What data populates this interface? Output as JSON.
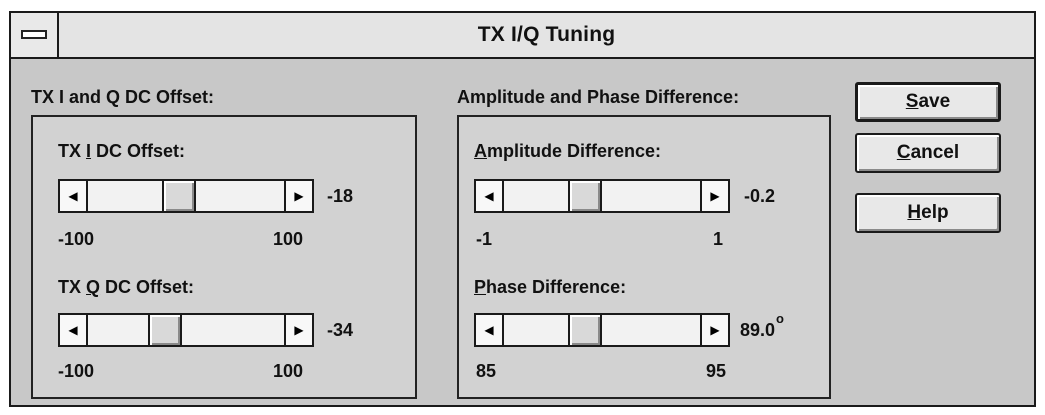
{
  "window": {
    "title": "TX I/Q Tuning"
  },
  "dc_offset": {
    "group_label": "TX I and Q DC Offset:",
    "i_slider": {
      "label_prefix": "TX ",
      "label_accel": "I",
      "label_suffix": " DC Offset:",
      "value": "-18",
      "min": "-100",
      "max": "100",
      "numeric_value": -18
    },
    "q_slider": {
      "label_prefix": "TX ",
      "label_accel": "Q",
      "label_suffix": " DC Offset:",
      "value": "-34",
      "min": "-100",
      "max": "100",
      "numeric_value": -34
    }
  },
  "amp_phase": {
    "group_label": "Amplitude and Phase Difference:",
    "amplitude": {
      "label_accel": "A",
      "label_rest": "mplitude Difference:",
      "value": "-0.2",
      "min": "-1",
      "max": "1",
      "numeric_value": -0.2
    },
    "phase": {
      "label_accel": "P",
      "label_rest": "hase Difference:",
      "value": "89.0",
      "unit": "o",
      "min": "85",
      "max": "95",
      "numeric_value": 89.0
    }
  },
  "buttons": {
    "save": {
      "accel": "S",
      "rest": "ave"
    },
    "cancel": {
      "accel": "C",
      "rest": "ancel"
    },
    "help": {
      "accel": "H",
      "rest": "elp"
    }
  },
  "icons": {
    "left_arrow": "left-arrow-icon",
    "right_arrow": "right-arrow-icon",
    "system_menu": "system-menu-icon"
  }
}
